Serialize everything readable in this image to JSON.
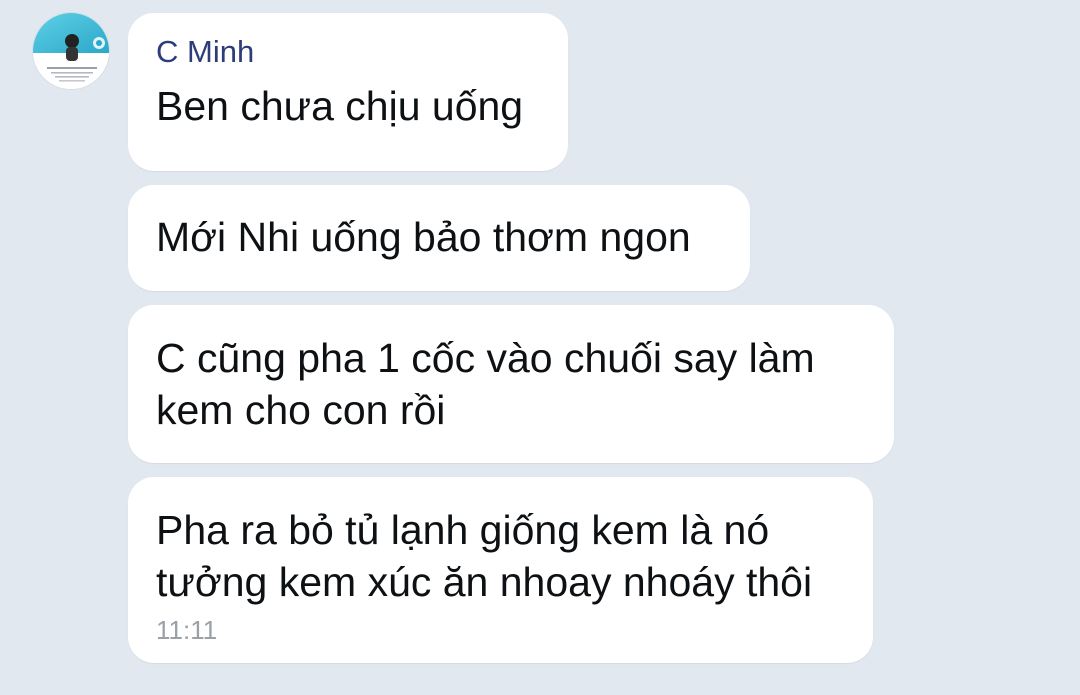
{
  "conversation": {
    "sender": {
      "name": "C Minh",
      "avatar_icon": "profile-photo-icon"
    },
    "messages": [
      {
        "text": "Ben chưa chịu uống"
      },
      {
        "text": "Mới Nhi uống bảo thơm ngon"
      },
      {
        "text": "C cũng pha 1 cốc vào chuối say làm kem cho con rồi"
      },
      {
        "text": "Pha ra bỏ tủ lạnh giống kem là nó tưởng kem xúc ăn nhoay nhoáy thôi",
        "time": "11:11"
      }
    ]
  },
  "colors": {
    "background": "#e2e8f0",
    "bubble": "#ffffff",
    "sender_name": "#2d3d7a",
    "text": "#0e1114",
    "timestamp": "#9aa0a8"
  }
}
